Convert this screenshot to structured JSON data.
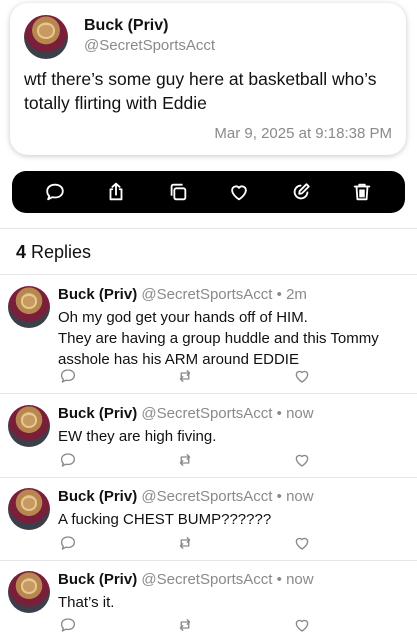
{
  "post": {
    "author_name": "Buck (Priv)",
    "author_handle": "@SecretSportsAcct",
    "text": "wtf there’s some guy here at basketball who’s totally flirting with Eddie",
    "timestamp": "Mar 9, 2025 at 9:18:38 PM"
  },
  "actions": [
    "reply-icon",
    "share-icon",
    "copy-icon",
    "like-icon",
    "edit-icon",
    "delete-icon"
  ],
  "replies_header": {
    "count": "4",
    "label": "Replies"
  },
  "replies": [
    {
      "name": "Buck (Priv)",
      "handle": "@SecretSportsAcct",
      "sep": "•",
      "time": "2m",
      "text_lines": [
        "Oh my god get your hands off of HIM.",
        "They are having a group huddle and this Tommy",
        "asshole has his ARM around EDDIE"
      ]
    },
    {
      "name": "Buck (Priv)",
      "handle": "@SecretSportsAcct",
      "sep": "•",
      "time": "now",
      "text_lines": [
        "EW they are high fiving."
      ]
    },
    {
      "name": "Buck (Priv)",
      "handle": "@SecretSportsAcct",
      "sep": "•",
      "time": "now",
      "text_lines": [
        "A fucking CHEST BUMP??????"
      ]
    },
    {
      "name": "Buck (Priv)",
      "handle": "@SecretSportsAcct",
      "sep": "•",
      "time": "now",
      "text_lines": [
        "That’s it."
      ]
    }
  ],
  "colors": {
    "muted": "#8a8a8e",
    "bar": "#000000",
    "icon_white": "#ffffff",
    "reply_icon": "#8a8a8e"
  }
}
